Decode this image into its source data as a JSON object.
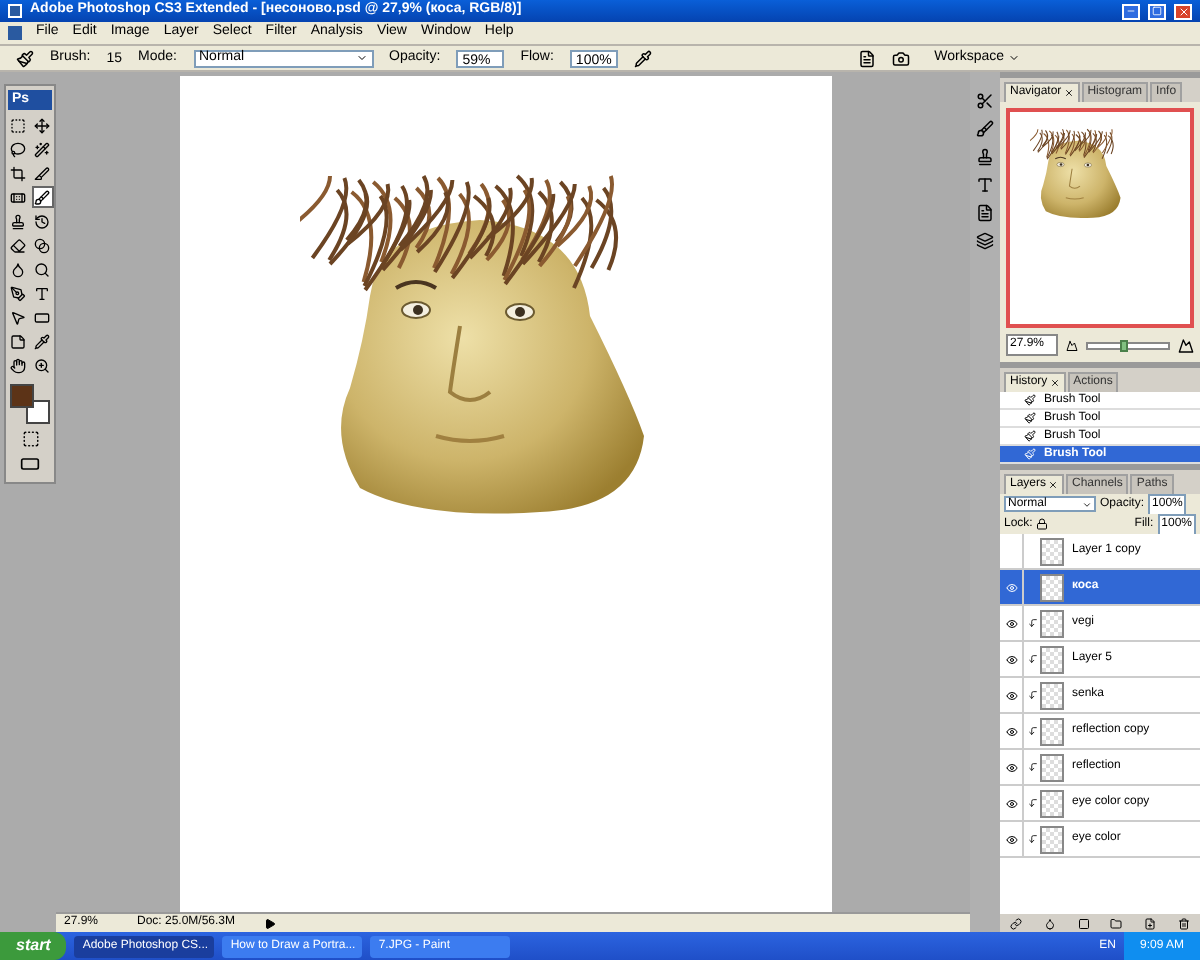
{
  "window": {
    "title": "Adobe Photoshop CS3 Extended - [несоново.psd @ 27,9% (коса, RGB/8)]"
  },
  "menu": [
    "File",
    "Edit",
    "Image",
    "Layer",
    "Select",
    "Filter",
    "Analysis",
    "View",
    "Window",
    "Help"
  ],
  "options_bar": {
    "brush_label": "Brush:",
    "brush_size": "15",
    "mode_label": "Mode:",
    "mode": "Normal",
    "opacity_label": "Opacity:",
    "opacity": "59%",
    "flow_label": "Flow:",
    "flow": "100%",
    "workspace": "Workspace"
  },
  "toolbox": {
    "logo": "Ps",
    "tools": [
      {
        "kind": "marquee",
        "selected": false
      },
      {
        "kind": "move",
        "selected": false
      },
      {
        "kind": "lasso",
        "selected": false
      },
      {
        "kind": "wand",
        "selected": false
      },
      {
        "kind": "crop",
        "selected": false
      },
      {
        "kind": "slice",
        "selected": false
      },
      {
        "kind": "heal",
        "selected": false
      },
      {
        "kind": "brush",
        "selected": true
      },
      {
        "kind": "stamp",
        "selected": false
      },
      {
        "kind": "history",
        "selected": false
      },
      {
        "kind": "eraser",
        "selected": false
      },
      {
        "kind": "gradient",
        "selected": false
      },
      {
        "kind": "blur",
        "selected": false
      },
      {
        "kind": "dodge",
        "selected": false
      },
      {
        "kind": "pen",
        "selected": false
      },
      {
        "kind": "type",
        "selected": false
      },
      {
        "kind": "select",
        "selected": false
      },
      {
        "kind": "shape",
        "selected": false
      },
      {
        "kind": "notes",
        "selected": false
      },
      {
        "kind": "eyedropper",
        "selected": false
      },
      {
        "kind": "hand",
        "selected": false
      },
      {
        "kind": "zoom",
        "selected": false
      }
    ],
    "foreground": {
      "color": "#5c3317"
    },
    "background": {
      "color": "#ffffff"
    }
  },
  "status_bar": {
    "zoom": "27.9%",
    "doc": "Doc: 25.0M/56.3M"
  },
  "navigator": {
    "tabs": [
      {
        "label": "Navigator",
        "selected": true
      },
      {
        "label": "Histogram",
        "selected": false
      },
      {
        "label": "Info",
        "selected": false
      }
    ],
    "zoom": "27.9%",
    "level": 0.45
  },
  "history": {
    "tabs": [
      {
        "label": "History",
        "selected": true
      },
      {
        "label": "Actions",
        "selected": false
      }
    ],
    "items": [
      {
        "label": "Brush Tool",
        "selected": false
      },
      {
        "label": "Brush Tool",
        "selected": false
      },
      {
        "label": "Brush Tool",
        "selected": false
      },
      {
        "label": "Brush Tool",
        "selected": true
      }
    ]
  },
  "layers": {
    "tabs": [
      {
        "label": "Layers",
        "selected": true
      },
      {
        "label": "Channels",
        "selected": false
      },
      {
        "label": "Paths",
        "selected": false
      }
    ],
    "blend_mode": "Normal",
    "opacity_label": "Opacity:",
    "opacity": "100%",
    "lock_label": "Lock:",
    "fill_label": "Fill:",
    "fill": "100%",
    "items": [
      {
        "name": "Layer 1 copy",
        "visible": false,
        "clipped": false,
        "selected": false
      },
      {
        "name": "коса",
        "visible": true,
        "clipped": false,
        "selected": true
      },
      {
        "name": "vegi",
        "visible": true,
        "clipped": true,
        "selected": false
      },
      {
        "name": "Layer 5",
        "visible": true,
        "clipped": true,
        "selected": false
      },
      {
        "name": "senka",
        "visible": true,
        "clipped": true,
        "selected": false
      },
      {
        "name": "reflection copy",
        "visible": true,
        "clipped": true,
        "selected": false
      },
      {
        "name": "reflection",
        "visible": true,
        "clipped": true,
        "selected": false
      },
      {
        "name": "eye color copy",
        "visible": true,
        "clipped": true,
        "selected": false
      },
      {
        "name": "eye color",
        "visible": true,
        "clipped": true,
        "selected": false
      }
    ]
  },
  "taskbar": {
    "start": "start",
    "tasks": [
      {
        "label": "Adobe Photoshop CS...",
        "selected": true
      },
      {
        "label": "How to Draw a Portra...",
        "selected": false
      },
      {
        "label": "7.JPG - Paint",
        "selected": false
      }
    ],
    "language": "EN",
    "clock": "9:09 AM"
  }
}
